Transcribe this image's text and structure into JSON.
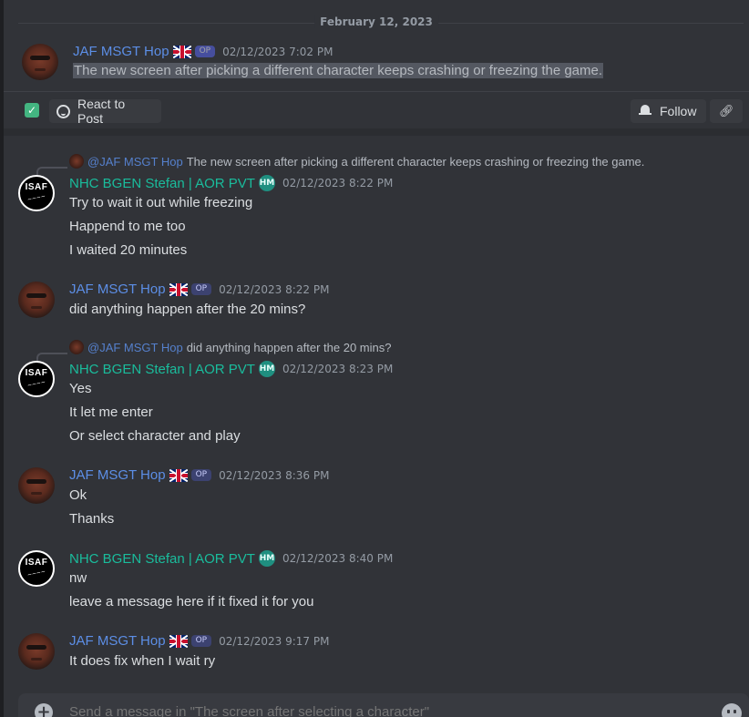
{
  "date_divider": "February 12, 2023",
  "post": {
    "author": "JAF MSGT Hop",
    "op_badge": "OP",
    "timestamp": "02/12/2023 7:02 PM",
    "content": "The new screen after picking a different character keeps crashing or freezing the game."
  },
  "actions": {
    "react_label": "React to Post",
    "follow_label": "Follow"
  },
  "messages": [
    {
      "reply_mention": "@JAF MSGT Hop",
      "reply_text": "The new screen after picking a different character keeps crashing or freezing the game.",
      "author": "NHC BGEN Stefan | AOR PVT",
      "role_badge": "HM",
      "timestamp": "02/12/2023 8:22 PM",
      "lines": [
        "Try to wait it out while freezing",
        "Happend to me too",
        "I waited 20 minutes"
      ]
    },
    {
      "author": "JAF MSGT Hop",
      "op_badge": "OP",
      "timestamp": "02/12/2023 8:22 PM",
      "lines": [
        "did anything happen after the 20 mins?"
      ]
    },
    {
      "reply_mention": "@JAF MSGT Hop",
      "reply_text": "did anything happen after the 20 mins?",
      "author": "NHC BGEN Stefan | AOR PVT",
      "role_badge": "HM",
      "timestamp": "02/12/2023 8:23 PM",
      "lines": [
        "Yes",
        "It let me enter",
        "Or select character and play"
      ]
    },
    {
      "author": "JAF MSGT Hop",
      "op_badge": "OP",
      "timestamp": "02/12/2023 8:36 PM",
      "lines": [
        "Ok",
        "Thanks"
      ]
    },
    {
      "author": "NHC BGEN Stefan | AOR PVT",
      "role_badge": "HM",
      "timestamp": "02/12/2023 8:40 PM",
      "lines": [
        "nw",
        "leave a message here if it fixed it for you"
      ]
    },
    {
      "author": "JAF MSGT Hop",
      "op_badge": "OP",
      "timestamp": "02/12/2023 9:17 PM",
      "lines": [
        "It does fix when I wait ry"
      ]
    }
  ],
  "avatar_isaf_text": "ISAF",
  "composer": {
    "placeholder": "Send a message in \"The screen after selecting a character\""
  },
  "colors": {
    "background": "#313338",
    "hop_name": "#5c8ee6",
    "stefan_name": "#1abc9c",
    "hm_badge": "#1f8f80",
    "check_green": "#43b581"
  },
  "icons": [
    "check-icon",
    "react-icon",
    "bell-icon",
    "link-icon",
    "plus-icon",
    "emoji-icon",
    "uk-flag-icon"
  ]
}
